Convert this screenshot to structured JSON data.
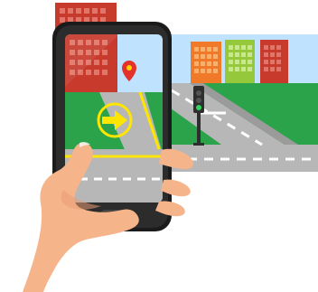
{
  "scene": {
    "colors": {
      "sky": "#bfe3ff",
      "grass": "#2aa34a",
      "road": "#b7b7b7",
      "road_dark": "#9b9b9b",
      "lane_white": "#ffffff",
      "lane_yellow": "#ffe600",
      "building_red": "#c73a2c",
      "building_orange": "#f07a2a",
      "building_green": "#95c83a",
      "phone_body": "#1b1b1b",
      "phone_edge": "#2c2c2c",
      "screen_highlight": "#ffffff",
      "arrow_ring": "#ffe600",
      "arrow_fill": "#ffe600",
      "pin_red": "#e3322b",
      "pin_yellow": "#ffd400",
      "signal_pole": "#2e2e2e",
      "signal_green": "#31d65a",
      "skin": "#f6b48a",
      "skin_shadow": "#e79d74"
    },
    "icons": {
      "ar_arrow": "right-arrow-icon",
      "location_pin": "location-pin-icon",
      "traffic_light": "traffic-light-icon",
      "home_button": "home-button-icon"
    }
  }
}
